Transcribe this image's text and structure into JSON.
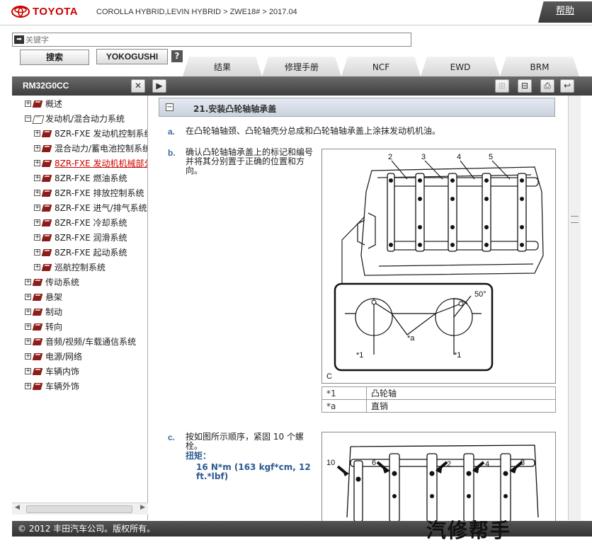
{
  "header": {
    "brand": "TOYOTA",
    "breadcrumb": "COROLLA HYBRID,LEVIN HYBRID > ZWE18# > 2017.04",
    "help": "帮助"
  },
  "search": {
    "placeholder": "关键字",
    "search_btn": "搜索",
    "yoko_btn": "YOKOGUSHI",
    "q": "?"
  },
  "tabs": [
    "结果",
    "修理手册",
    "NCF",
    "EWD",
    "BRM"
  ],
  "toolbar": {
    "title": "RM32G0CC",
    "close": "✕",
    "next": "▶"
  },
  "tree": [
    {
      "label": "概述",
      "pm": "+",
      "indent": 0,
      "open": false,
      "active": false
    },
    {
      "label": "发动机/混合动力系统",
      "pm": "−",
      "indent": 0,
      "open": true,
      "active": false
    },
    {
      "label": "8ZR-FXE 发动机控制系统",
      "pm": "+",
      "indent": 1,
      "open": false,
      "active": false
    },
    {
      "label": "混合动力/蓄电池控制系统",
      "pm": "+",
      "indent": 1,
      "open": false,
      "active": false
    },
    {
      "label": "8ZR-FXE 发动机机械部分",
      "pm": "+",
      "indent": 1,
      "open": false,
      "active": true
    },
    {
      "label": "8ZR-FXE 燃油系统",
      "pm": "+",
      "indent": 1,
      "open": false,
      "active": false
    },
    {
      "label": "8ZR-FXE 排放控制系统",
      "pm": "+",
      "indent": 1,
      "open": false,
      "active": false
    },
    {
      "label": "8ZR-FXE 进气/排气系统",
      "pm": "+",
      "indent": 1,
      "open": false,
      "active": false
    },
    {
      "label": "8ZR-FXE 冷却系统",
      "pm": "+",
      "indent": 1,
      "open": false,
      "active": false
    },
    {
      "label": "8ZR-FXE 润滑系统",
      "pm": "+",
      "indent": 1,
      "open": false,
      "active": false
    },
    {
      "label": "8ZR-FXE 起动系统",
      "pm": "+",
      "indent": 1,
      "open": false,
      "active": false
    },
    {
      "label": "巡航控制系统",
      "pm": "+",
      "indent": 1,
      "open": false,
      "active": false
    },
    {
      "label": "传动系统",
      "pm": "+",
      "indent": 0,
      "open": false,
      "active": false
    },
    {
      "label": "悬架",
      "pm": "+",
      "indent": 0,
      "open": false,
      "active": false
    },
    {
      "label": "制动",
      "pm": "+",
      "indent": 0,
      "open": false,
      "active": false
    },
    {
      "label": "转向",
      "pm": "+",
      "indent": 0,
      "open": false,
      "active": false
    },
    {
      "label": "音频/视频/车载通信系统",
      "pm": "+",
      "indent": 0,
      "open": false,
      "active": false
    },
    {
      "label": "电源/网络",
      "pm": "+",
      "indent": 0,
      "open": false,
      "active": false
    },
    {
      "label": "车辆内饰",
      "pm": "+",
      "indent": 0,
      "open": false,
      "active": false
    },
    {
      "label": "车辆外饰",
      "pm": "+",
      "indent": 0,
      "open": false,
      "active": false
    }
  ],
  "content": {
    "section_title": "21.安装凸轮轴轴承盖",
    "step_a_label": "a.",
    "step_a_text": "在凸轮轴轴颈、凸轮轴壳分总成和凸轮轴轴承盖上涂抹发动机机油。",
    "step_b_label": "b.",
    "step_b_text": "确认凸轮轴轴承盖上的标记和编号并将其分别置于正确的位置和方向。",
    "step_c_label": "c.",
    "step_c_text": "按如图所示顺序，紧固 10 个螺栓。",
    "torque_label": "扭矩：",
    "torque_value": "16 N*m (163 kgf*cm, 12 ft.*lbf)",
    "fig1": {
      "nums": [
        "2",
        "3",
        "4",
        "5"
      ],
      "angle": "50°",
      "a": "*a",
      "one_l": "*1",
      "one_r": "*1",
      "c": "C"
    },
    "fig2": {
      "nums": [
        "10",
        "6",
        "2",
        "4",
        "8"
      ]
    },
    "legend": [
      {
        "k": "*1",
        "v": "凸轮轴"
      },
      {
        "k": "*a",
        "v": "直销"
      }
    ]
  },
  "footer": "© 2012 丰田汽车公司。版权所有。",
  "watermark": "汽修帮手"
}
